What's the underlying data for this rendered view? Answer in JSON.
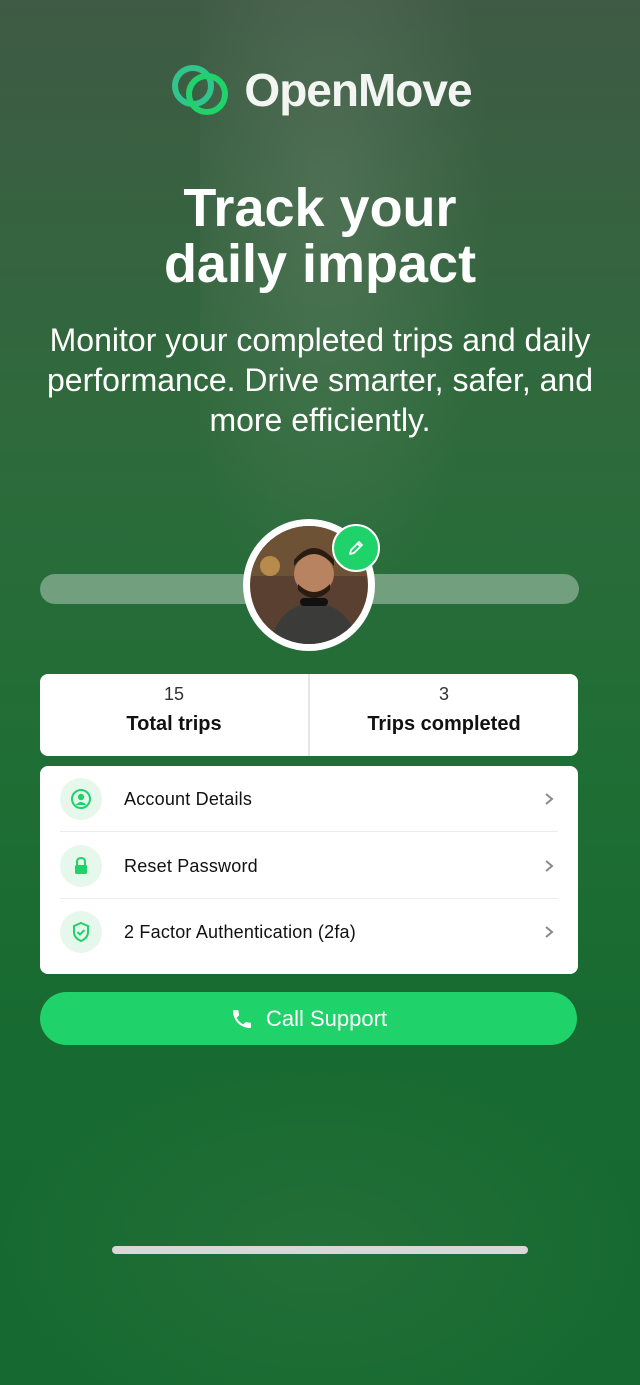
{
  "brand": {
    "name": "OpenMove",
    "accent": "#1fd26a"
  },
  "hero": {
    "headline_line1": "Track your",
    "headline_line2": "daily impact",
    "subtext": "Monitor your completed trips and daily performance. Drive smarter, safer, and more efficiently."
  },
  "profile": {
    "avatar_icon": "user-avatar",
    "edit_icon": "pencil-icon"
  },
  "stats": [
    {
      "value": "15",
      "label": "Total trips"
    },
    {
      "value": "3",
      "label": "Trips completed"
    }
  ],
  "menu": [
    {
      "label": "Account Details",
      "icon": "user-circle-icon"
    },
    {
      "label": "Reset Password",
      "icon": "lock-icon"
    },
    {
      "label": "2 Factor Authentication (2fa)",
      "icon": "shield-check-icon"
    }
  ],
  "cta": {
    "label": "Call Support",
    "icon": "phone-icon"
  }
}
